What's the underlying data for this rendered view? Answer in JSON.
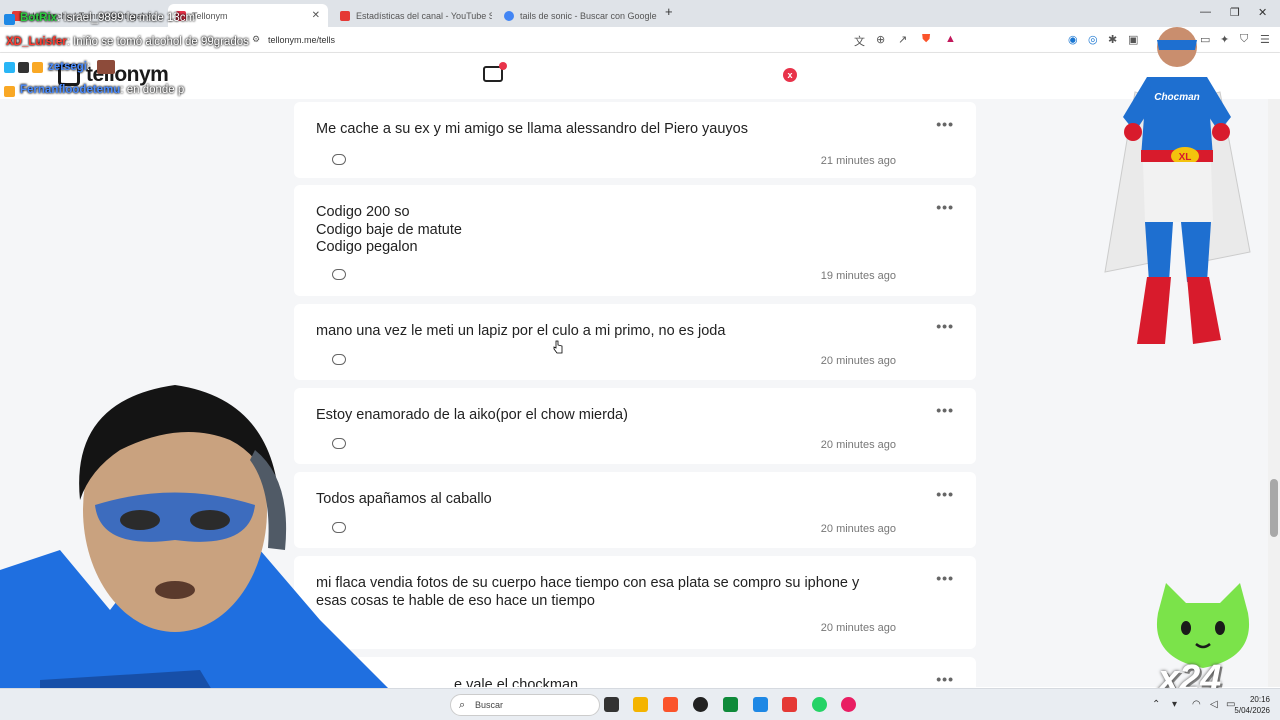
{
  "browser": {
    "tabs": [
      {
        "label": "Una noche | Tommy Portugal &...",
        "color": "#e53935",
        "active": false
      },
      {
        "label": "Tellonym",
        "color": "#e8334a",
        "active": true
      },
      {
        "label": "Estadísticas del canal - YouTube Studi",
        "color": "#e53935",
        "active": false
      },
      {
        "label": "tails de sonic - Buscar con Google",
        "color": "#4285f4",
        "active": false
      }
    ],
    "new_tab": "+",
    "url": "tellonym.me/tells"
  },
  "app": {
    "logo": "tellonym",
    "close_label": "x"
  },
  "tells": [
    {
      "text": "Me cache a su ex y mi amigo se llama alessandro del Piero yauyos",
      "time": "21 minutes ago"
    },
    {
      "text": "Codigo 200 so\nCodigo baje de matute\nCodigo pegalon",
      "time": "19 minutes ago"
    },
    {
      "text": "mano una vez le meti un lapiz por el culo a mi primo, no es joda",
      "time": "20 minutes ago"
    },
    {
      "text": "Estoy enamorado de la aiko(por el chow mierda)",
      "time": "20 minutes ago"
    },
    {
      "text": "Todos apañamos al caballo",
      "time": "20 minutes ago"
    },
    {
      "text": "mi flaca vendia fotos de su cuerpo hace tiempo con esa plata se compro su iphone y\nesas cosas te hable de eso hace un tiempo",
      "time": "20 minutes ago"
    },
    {
      "text": "e vale el chockman",
      "time": ""
    }
  ],
  "more_label": "•••",
  "chat": [
    {
      "user": "BotRix",
      "message": ": Israel_9899 le mide 13cm",
      "color": "#2ecc40"
    },
    {
      "user": "XD_Luisfer",
      "message": ": Iniño se tomó alcohol de 99grados",
      "color": "#ff3b30"
    },
    {
      "user": "zetsegi",
      "message": ":",
      "color": "#4a8cff"
    },
    {
      "user": "Fernanfloodetemu",
      "message": ": en donde p",
      "color": "#4a8cff"
    }
  ],
  "overlay": {
    "hero_brand": "Chocman",
    "hero_belt": "XL",
    "multiplier": "x24"
  },
  "taskbar": {
    "search_placeholder": "Buscar",
    "time": "20:16",
    "date": "5/04/2026"
  }
}
